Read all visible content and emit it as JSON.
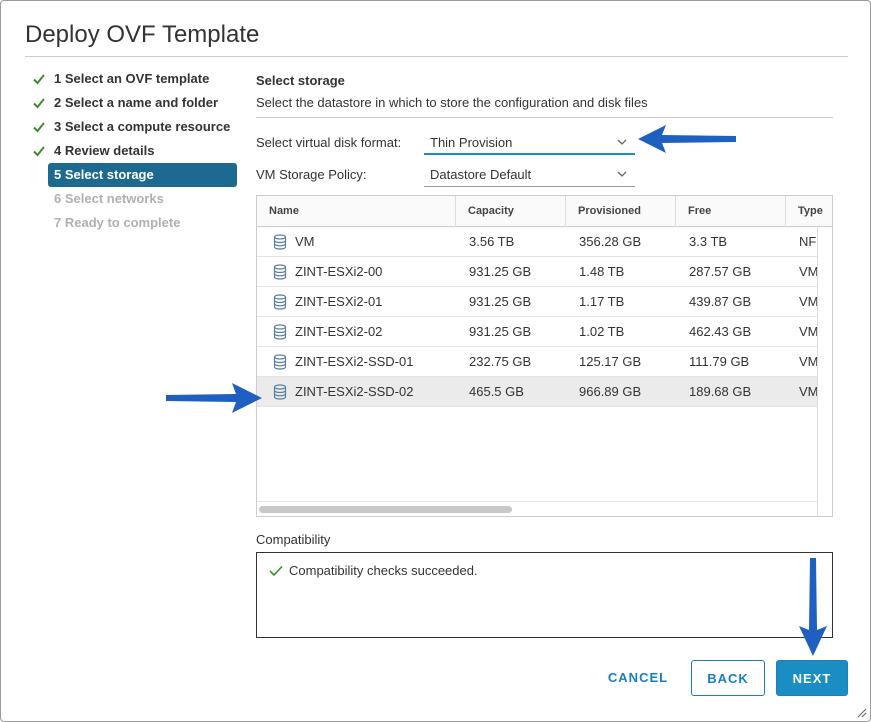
{
  "dialog": {
    "title": "Deploy OVF Template"
  },
  "steps": [
    {
      "label": "1 Select an OVF template",
      "state": "done"
    },
    {
      "label": "2 Select a name and folder",
      "state": "done"
    },
    {
      "label": "3 Select a compute resource",
      "state": "done"
    },
    {
      "label": "4 Review details",
      "state": "done"
    },
    {
      "label": "5 Select storage",
      "state": "active"
    },
    {
      "label": "6 Select networks",
      "state": "disabled"
    },
    {
      "label": "7 Ready to complete",
      "state": "disabled"
    }
  ],
  "storage": {
    "title": "Select storage",
    "description": "Select the datastore in which to store the configuration and disk files",
    "disk_format_label": "Select virtual disk format:",
    "disk_format_value": "Thin Provision",
    "policy_label": "VM Storage Policy:",
    "policy_value": "Datastore Default"
  },
  "table": {
    "columns": [
      "Name",
      "Capacity",
      "Provisioned",
      "Free",
      "Type"
    ],
    "rows": [
      {
        "name": "VM",
        "capacity": "3.56 TB",
        "provisioned": "356.28 GB",
        "free": "3.3 TB",
        "type": "NFS",
        "selected": false
      },
      {
        "name": "ZINT-ESXi2-00",
        "capacity": "931.25 GB",
        "provisioned": "1.48 TB",
        "free": "287.57 GB",
        "type": "VMFS",
        "selected": false
      },
      {
        "name": "ZINT-ESXi2-01",
        "capacity": "931.25 GB",
        "provisioned": "1.17 TB",
        "free": "439.87 GB",
        "type": "VMFS",
        "selected": false
      },
      {
        "name": "ZINT-ESXi2-02",
        "capacity": "931.25 GB",
        "provisioned": "1.02 TB",
        "free": "462.43 GB",
        "type": "VMFS",
        "selected": false
      },
      {
        "name": "ZINT-ESXi2-SSD-01",
        "capacity": "232.75 GB",
        "provisioned": "125.17 GB",
        "free": "111.79 GB",
        "type": "VMFS",
        "selected": false
      },
      {
        "name": "ZINT-ESXi2-SSD-02",
        "capacity": "465.5 GB",
        "provisioned": "966.89 GB",
        "free": "189.68 GB",
        "type": "VMFS",
        "selected": true
      }
    ]
  },
  "compatibility": {
    "label": "Compatibility",
    "message": "Compatibility checks succeeded."
  },
  "buttons": {
    "cancel": "CANCEL",
    "back": "BACK",
    "next": "NEXT"
  },
  "icons": {
    "step_done": "checkmark-icon",
    "datastore": "database-icon",
    "compat_ok": "checkmark-icon",
    "dropdown": "chevron-down-icon"
  },
  "colors": {
    "accent": "#1a8ec2",
    "active_step": "#1c6a8f",
    "success": "#3c8d2f",
    "annotation_arrow": "#1f5fbf"
  }
}
